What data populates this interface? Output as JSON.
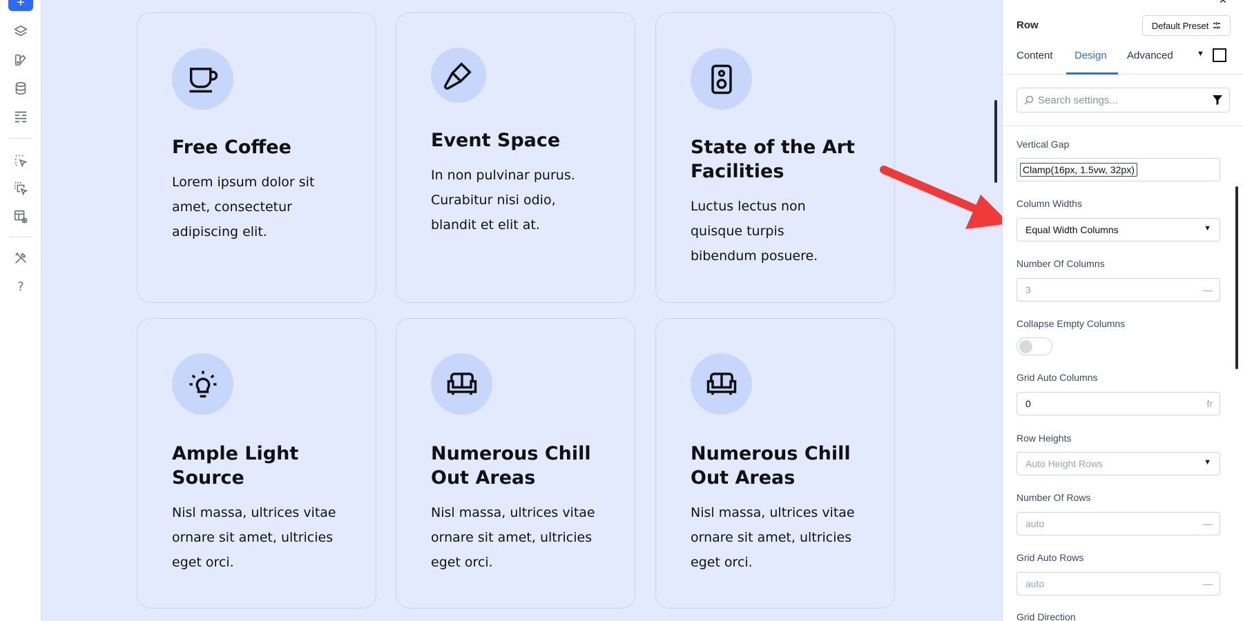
{
  "toolbar": {
    "add_label": "+",
    "items": [
      {
        "icon": "layers-icon"
      },
      {
        "icon": "palette-icon"
      },
      {
        "icon": "database-icon"
      },
      {
        "icon": "layout-icon"
      },
      {
        "icon": "click-select-icon"
      },
      {
        "icon": "multi-select-icon"
      },
      {
        "icon": "preview-icon"
      },
      {
        "icon": "tools-icon"
      }
    ],
    "help_label": "?"
  },
  "cards": [
    {
      "icon": "coffee-cup-icon",
      "title": "Free Coffee",
      "body_lines": [
        "Lorem ipsum dolor sit",
        "amet, consectetur",
        "adipiscing elit."
      ]
    },
    {
      "icon": "microphone-icon",
      "title": "Event Space",
      "body_lines": [
        "In non pulvinar purus.",
        "Curabitur nisi odio,",
        "blandit et elit at."
      ]
    },
    {
      "icon": "speaker-icon",
      "title_lines": [
        "State of the Art",
        "Facilities"
      ],
      "body_lines": [
        "Luctus lectus non",
        "quisque turpis",
        "bibendum posuere."
      ]
    },
    {
      "icon": "lightbulb-icon",
      "title_lines": [
        "Ample Light",
        "Source"
      ],
      "body_lines": [
        "Nisl massa, ultrices vitae",
        "ornare sit amet, ultricies",
        "eget orci."
      ]
    },
    {
      "icon": "sofa-icon",
      "title_lines": [
        "Numerous Chill",
        "Out Areas"
      ],
      "body_lines": [
        "Nisl massa, ultrices vitae",
        "ornare sit amet, ultricies",
        "eget orci."
      ]
    },
    {
      "icon": "sofa-icon",
      "title_lines": [
        "Numerous Chill",
        "Out Areas"
      ],
      "body_lines": [
        "Nisl massa, ultrices vitae",
        "ornare sit amet, ultricies",
        "eget orci."
      ]
    }
  ],
  "panel": {
    "element_title": "Row",
    "preset_label": "Default Preset",
    "tabs": [
      "Content",
      "Design",
      "Advanced"
    ],
    "active_tab": "Design",
    "search_placeholder": "Search settings...",
    "fields": {
      "vertical_gap": {
        "label": "Vertical Gap",
        "value": "Clamp(16px, 1.5vw, 32px)"
      },
      "column_widths": {
        "label": "Column Widths",
        "value": "Equal Width Columns"
      },
      "number_of_columns": {
        "label": "Number Of Columns",
        "value": "3",
        "suffix": "—"
      },
      "collapse_empty_columns": {
        "label": "Collapse Empty Columns",
        "enabled": false
      },
      "grid_auto_columns": {
        "label": "Grid Auto Columns",
        "value": "0",
        "suffix": "fr"
      },
      "row_heights": {
        "label": "Row Heights",
        "value": "Auto Height Rows"
      },
      "number_of_rows": {
        "label": "Number Of Rows",
        "value": "auto",
        "suffix": "—"
      },
      "grid_auto_rows": {
        "label": "Grid Auto Rows",
        "value": "auto",
        "suffix": "—"
      },
      "grid_direction": {
        "label": "Grid Direction"
      }
    }
  },
  "colors": {
    "accent": "#2f6af5",
    "canvas_bg": "#e3eafd",
    "icon_circle": "#c6d7fb",
    "arrow": "#f03a3a"
  }
}
